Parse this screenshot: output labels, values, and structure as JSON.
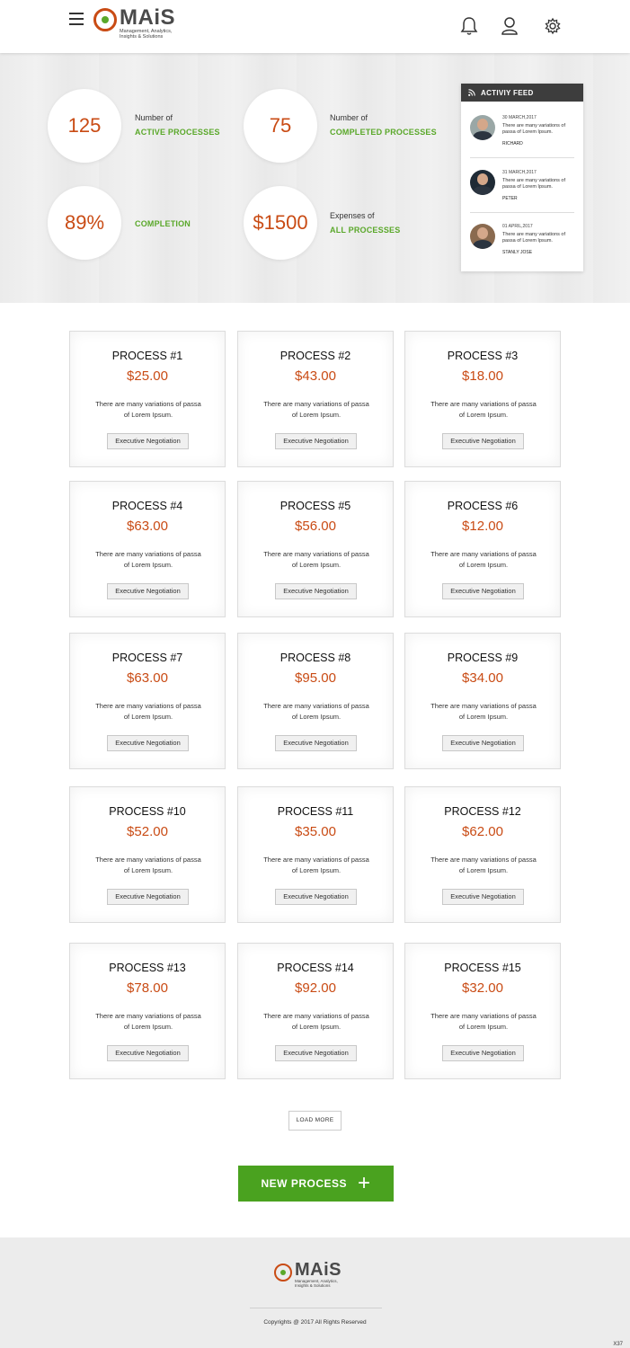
{
  "header": {
    "logo_name": "MAiS",
    "logo_tagline": "Management, Analytics, Insights & Solutions"
  },
  "stats": [
    {
      "value": "125",
      "label_top": "Number of",
      "label_accent": "ACTIVE PROCESSES"
    },
    {
      "value": "75",
      "label_top": "Number of",
      "label_accent": "COMPLETED PROCESSES"
    },
    {
      "value": "89%",
      "label_top": "",
      "label_accent": "COMPLETION"
    },
    {
      "value": "$1500",
      "label_top": "Expenses of",
      "label_accent": "ALL PROCESSES"
    }
  ],
  "feed": {
    "title": "ACTIVIY FEED",
    "items": [
      {
        "date": "30 MARCH,2017",
        "message": "There are many variations of passa of Lorem Ipsum.",
        "name": "RICHARD"
      },
      {
        "date": "31 MARCH,2017",
        "message": "There are many variations of passa of Lorem Ipsum.",
        "name": "PETER"
      },
      {
        "date": "01 APRIL,2017",
        "message": "There are many variations of passa of Lorem Ipsum.",
        "name": "STANLY JOSE"
      }
    ]
  },
  "processes": [
    {
      "title": "PROCESS #1",
      "price": "$25.00",
      "desc": "There are many variations of passa of Lorem Ipsum.",
      "tag": "Executive Negotiation"
    },
    {
      "title": "PROCESS #2",
      "price": "$43.00",
      "desc": "There are many variations of passa of Lorem Ipsum.",
      "tag": "Executive Negotiation"
    },
    {
      "title": "PROCESS #3",
      "price": "$18.00",
      "desc": "There are many variations of passa of Lorem Ipsum.",
      "tag": "Executive Negotiation"
    },
    {
      "title": "PROCESS #4",
      "price": "$63.00",
      "desc": "There are many variations of passa of Lorem Ipsum.",
      "tag": "Executive Negotiation"
    },
    {
      "title": "PROCESS #5",
      "price": "$56.00",
      "desc": "There are many variations of passa of Lorem Ipsum.",
      "tag": "Executive Negotiation"
    },
    {
      "title": "PROCESS #6",
      "price": "$12.00",
      "desc": "There are many variations of passa of Lorem Ipsum.",
      "tag": "Executive Negotiation"
    },
    {
      "title": "PROCESS #7",
      "price": "$63.00",
      "desc": "There are many variations of passa of Lorem Ipsum.",
      "tag": "Executive Negotiation"
    },
    {
      "title": "PROCESS #8",
      "price": "$95.00",
      "desc": "There are many variations of passa of Lorem Ipsum.",
      "tag": "Executive Negotiation"
    },
    {
      "title": "PROCESS #9",
      "price": "$34.00",
      "desc": "There are many variations of passa of Lorem Ipsum.",
      "tag": "Executive Negotiation"
    },
    {
      "title": "PROCESS #10",
      "price": "$52.00",
      "desc": "There are many variations of passa of Lorem Ipsum.",
      "tag": "Executive Negotiation"
    },
    {
      "title": "PROCESS #11",
      "price": "$35.00",
      "desc": "There are many variations of passa of Lorem Ipsum.",
      "tag": "Executive Negotiation"
    },
    {
      "title": "PROCESS #12",
      "price": "$62.00",
      "desc": "There are many variations of passa of Lorem Ipsum.",
      "tag": "Executive Negotiation"
    },
    {
      "title": "PROCESS #13",
      "price": "$78.00",
      "desc": "There are many variations of passa of Lorem Ipsum.",
      "tag": "Executive Negotiation"
    },
    {
      "title": "PROCESS #14",
      "price": "$92.00",
      "desc": "There are many variations of passa of Lorem Ipsum.",
      "tag": "Executive Negotiation"
    },
    {
      "title": "PROCESS #15",
      "price": "$32.00",
      "desc": "There are many variations of passa of Lorem Ipsum.",
      "tag": "Executive Negotiation"
    }
  ],
  "actions": {
    "load_more": "LOAD MORE",
    "new_process": "NEW PROCESS",
    "new_process_icon": "plus-icon"
  },
  "footer": {
    "logo_name": "MAiS",
    "logo_tagline": "Management, Analytics, Insights & Solutions",
    "copyright": "Copyrights @ 2017 All Rights Reserved",
    "version": "X37"
  },
  "colors": {
    "accent_orange": "#c94b14",
    "accent_green": "#5aa82a",
    "button_green": "#4aa21f",
    "feed_header": "#3d3d3d"
  }
}
